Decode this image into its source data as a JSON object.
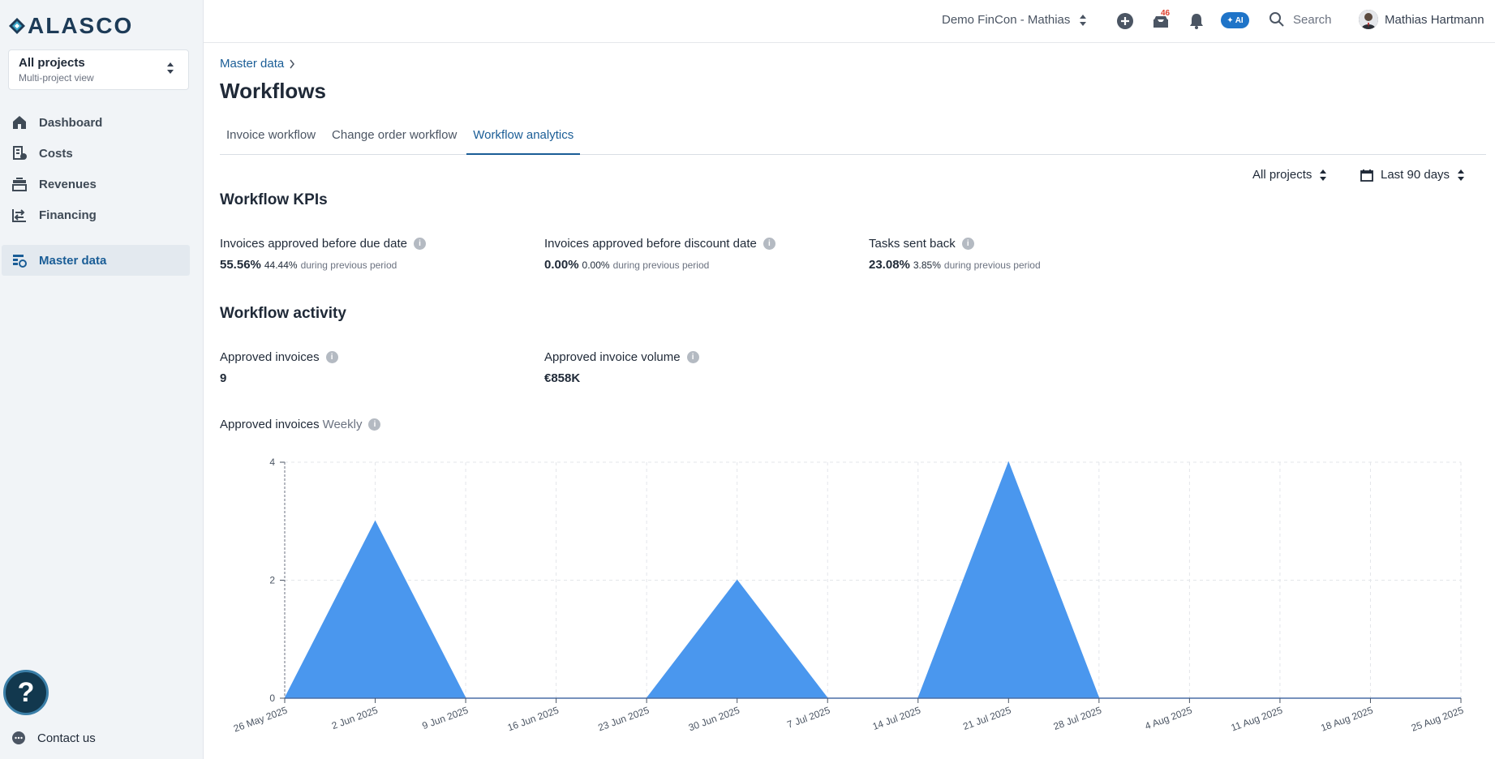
{
  "app": {
    "logo_text": "ALASCO",
    "project_selector": {
      "title": "All projects",
      "subtitle": "Multi-project view"
    },
    "nav": [
      {
        "label": "Dashboard",
        "icon": "home-icon"
      },
      {
        "label": "Costs",
        "icon": "costs-icon"
      },
      {
        "label": "Revenues",
        "icon": "revenues-icon"
      },
      {
        "label": "Financing",
        "icon": "financing-icon"
      }
    ],
    "nav_master": {
      "label": "Master data",
      "icon": "master-data-icon",
      "active": true
    },
    "help_label": "?",
    "contact_label": "Contact us"
  },
  "topbar": {
    "org": "Demo FinCon - Mathias",
    "notification_badge": "46",
    "ai_label": "AI",
    "search_label": "Search",
    "user_name": "Mathias Hartmann"
  },
  "page": {
    "breadcrumb": "Master data",
    "title": "Workflows",
    "tabs": [
      {
        "label": "Invoice workflow",
        "active": false
      },
      {
        "label": "Change order workflow",
        "active": false
      },
      {
        "label": "Workflow analytics",
        "active": true
      }
    ],
    "filter_projects": "All projects",
    "filter_period": "Last 90 days"
  },
  "kpis": {
    "title": "Workflow KPIs",
    "items": [
      {
        "label": "Invoices approved before due date",
        "value": "55.56%",
        "prev_value": "44.44%",
        "prev_text": "during previous period"
      },
      {
        "label": "Invoices approved before discount date",
        "value": "0.00%",
        "prev_value": "0.00%",
        "prev_text": "during previous period"
      },
      {
        "label": "Tasks sent back",
        "value": "23.08%",
        "prev_value": "3.85%",
        "prev_text": "during previous period"
      }
    ]
  },
  "activity": {
    "title": "Workflow activity",
    "items": [
      {
        "label": "Approved invoices",
        "value": "9"
      },
      {
        "label": "Approved invoice volume",
        "value": "€858K"
      }
    ],
    "chart_heading": "Approved invoices",
    "chart_subheading": "Weekly"
  },
  "colors": {
    "accent": "#1a5d96",
    "area": "#4a97ee",
    "sidebar_bg": "#f1f4f7"
  },
  "chart_data": {
    "type": "area",
    "title": "Approved invoices",
    "subtitle": "Weekly",
    "x": [
      "26 May 2025",
      "2 Jun 2025",
      "9 Jun 2025",
      "16 Jun 2025",
      "23 Jun 2025",
      "30 Jun 2025",
      "7 Jul 2025",
      "14 Jul 2025",
      "21 Jul 2025",
      "28 Jul 2025",
      "4 Aug 2025",
      "11 Aug 2025",
      "18 Aug 2025",
      "25 Aug 2025"
    ],
    "series": [
      {
        "values": [
          0,
          3,
          0,
          0,
          0,
          2,
          0,
          0,
          4,
          0,
          0,
          0,
          0,
          0
        ]
      }
    ],
    "yticks": [
      0,
      2,
      4
    ],
    "ylim": [
      0,
      4
    ],
    "grid": true,
    "color": "#4a97ee"
  }
}
